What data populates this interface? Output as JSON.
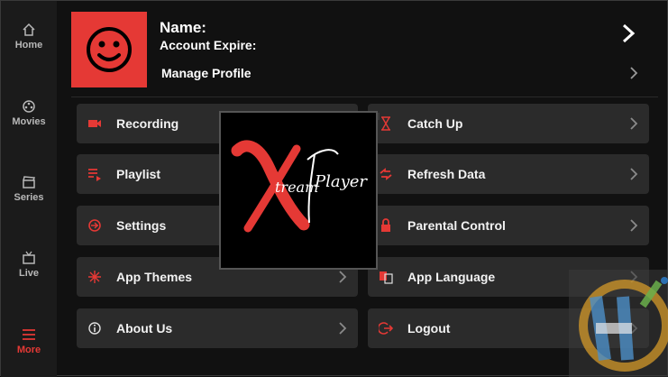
{
  "sidebar": {
    "items": [
      {
        "label": "Home",
        "icon": "home-icon"
      },
      {
        "label": "Movies",
        "icon": "film-reel-icon"
      },
      {
        "label": "Series",
        "icon": "clapperboard-icon"
      },
      {
        "label": "Live",
        "icon": "tv-icon"
      },
      {
        "label": "More",
        "icon": "menu-icon",
        "active": true
      }
    ]
  },
  "profile": {
    "name_label": "Name:",
    "expire_label": "Account Expire:",
    "manage_label": "Manage Profile",
    "avatar_icon": "smiley-face-icon"
  },
  "menu": [
    {
      "label": "Recording",
      "icon": "video-camera-icon"
    },
    {
      "label": "Catch Up",
      "icon": "hourglass-icon"
    },
    {
      "label": "Playlist",
      "icon": "playlist-icon"
    },
    {
      "label": "Refresh Data",
      "icon": "refresh-icon"
    },
    {
      "label": "Settings",
      "icon": "settings-icon"
    },
    {
      "label": "Parental Control",
      "icon": "lock-icon"
    },
    {
      "label": "App Themes",
      "icon": "themes-icon"
    },
    {
      "label": "App Language",
      "icon": "translate-icon"
    },
    {
      "label": "About Us",
      "icon": "info-icon"
    },
    {
      "label": "Logout",
      "icon": "logout-icon"
    }
  ],
  "logo": {
    "letter": "X",
    "word1": "tream",
    "word2": "Player"
  },
  "colors": {
    "accent": "#e53935",
    "panel": "#2b2b2b",
    "sidebar": "#1b1b1b",
    "background": "#111111"
  }
}
